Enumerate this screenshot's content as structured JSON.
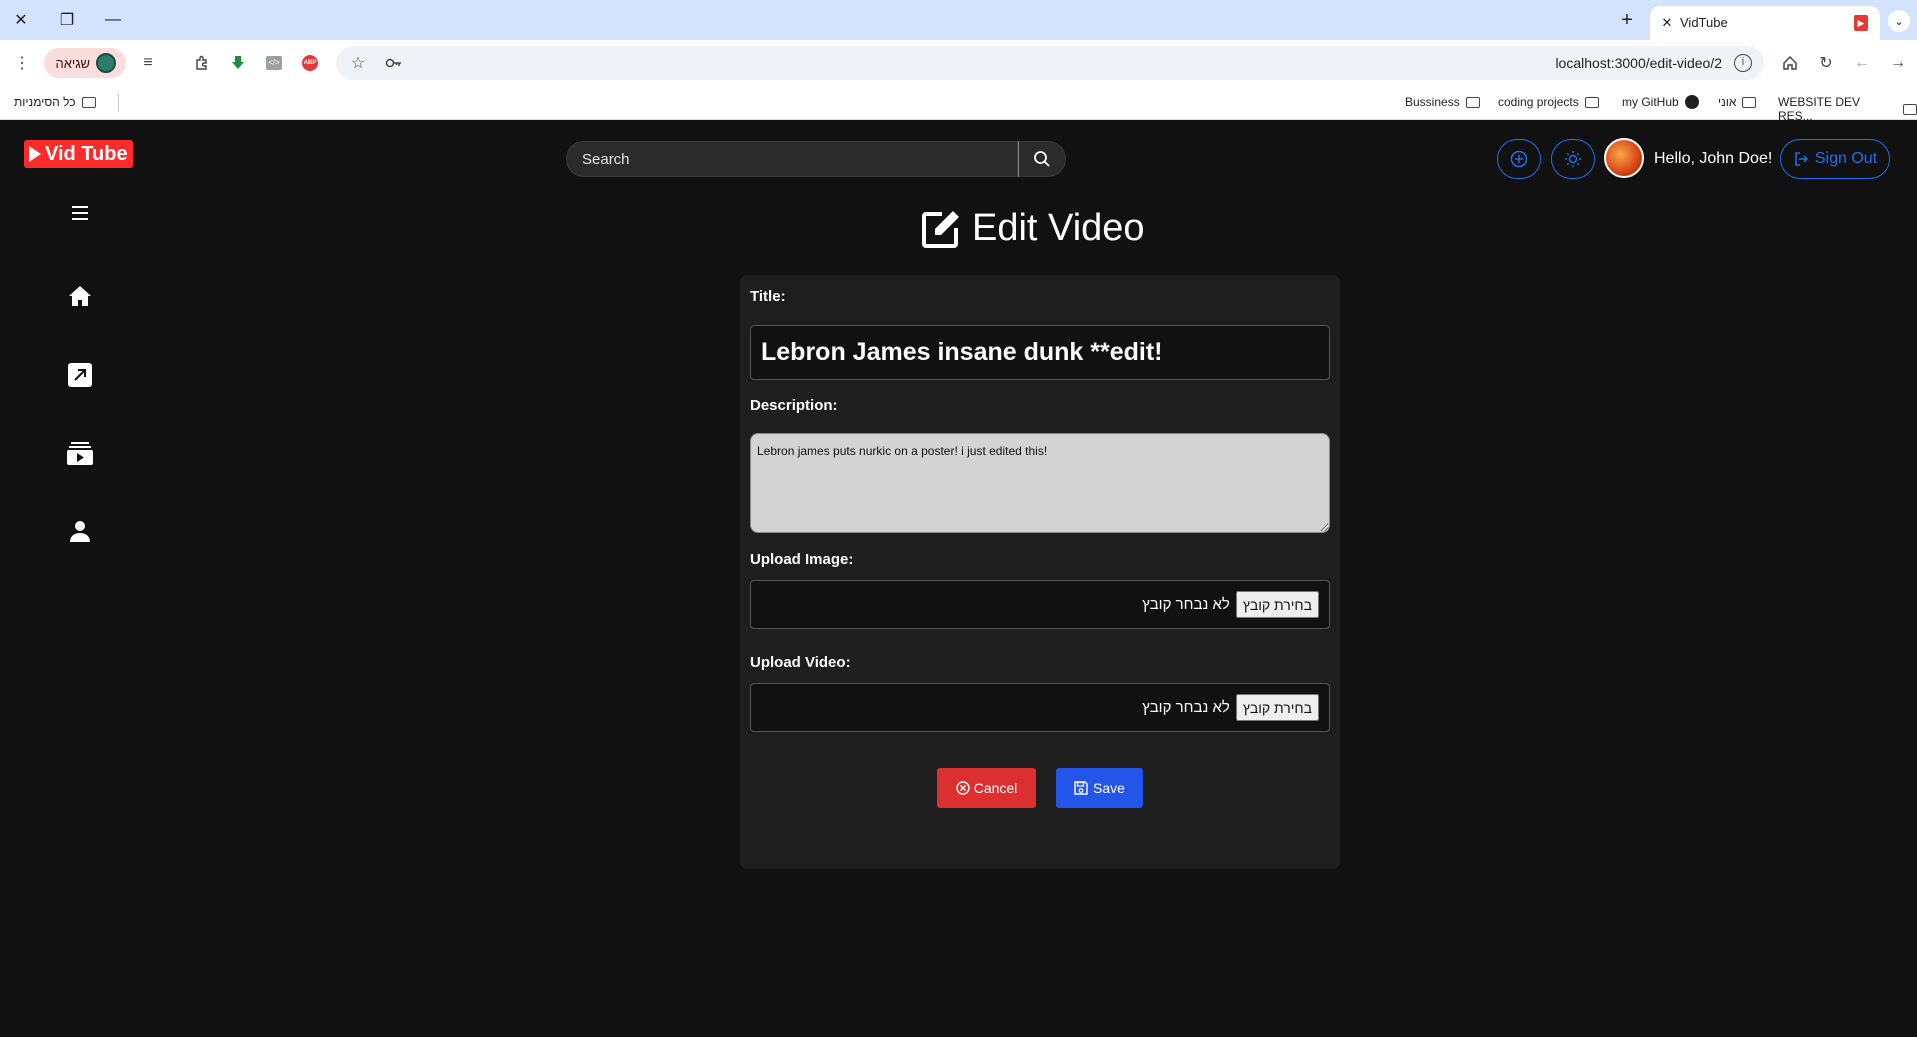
{
  "browser": {
    "tab_title": "VidTube",
    "url": "localhost:3000/edit-video/2",
    "profile_label": "שגיאה",
    "new_tab_symbol": "+",
    "bookmarks": [
      {
        "label": "כל הסימניות",
        "icon": "folder-icon"
      },
      {
        "label": "Bussiness",
        "icon": "folder-icon"
      },
      {
        "label": "coding projects",
        "icon": "folder-icon"
      },
      {
        "label": "my GitHub",
        "icon": "github-icon"
      },
      {
        "label": "אוני",
        "icon": "folder-icon"
      },
      {
        "label": "WEBSITE DEV RES...",
        "icon": "folder-icon"
      }
    ]
  },
  "header": {
    "logo_text": "Vid Tube",
    "search_placeholder": "Search",
    "greeting": "Hello, John Doe!",
    "signout_label": "Sign Out"
  },
  "sidebar": {
    "items": [
      {
        "icon": "menu-icon"
      },
      {
        "icon": "home-icon"
      },
      {
        "icon": "trending-icon"
      },
      {
        "icon": "subscriptions-icon"
      },
      {
        "icon": "profile-icon"
      }
    ]
  },
  "form": {
    "page_title": "Edit Video",
    "title_label": "Title:",
    "title_value": "Lebron James insane dunk **edit!",
    "description_label": "Description:",
    "description_value": "Lebron james puts nurkic on a poster! i just edited this!",
    "upload_image_label": "Upload Image:",
    "upload_video_label": "Upload Video:",
    "file_button_label": "בחירת קובץ",
    "file_status": "לא נבחר קובץ",
    "cancel_label": "Cancel",
    "save_label": "Save"
  },
  "colors": {
    "background": "#111111",
    "card": "#1e1e1e",
    "accent_blue": "#1f6feb",
    "cancel_red": "#dc2f2f",
    "save_blue": "#2356e8",
    "logo_red": "#ff2a2a"
  }
}
